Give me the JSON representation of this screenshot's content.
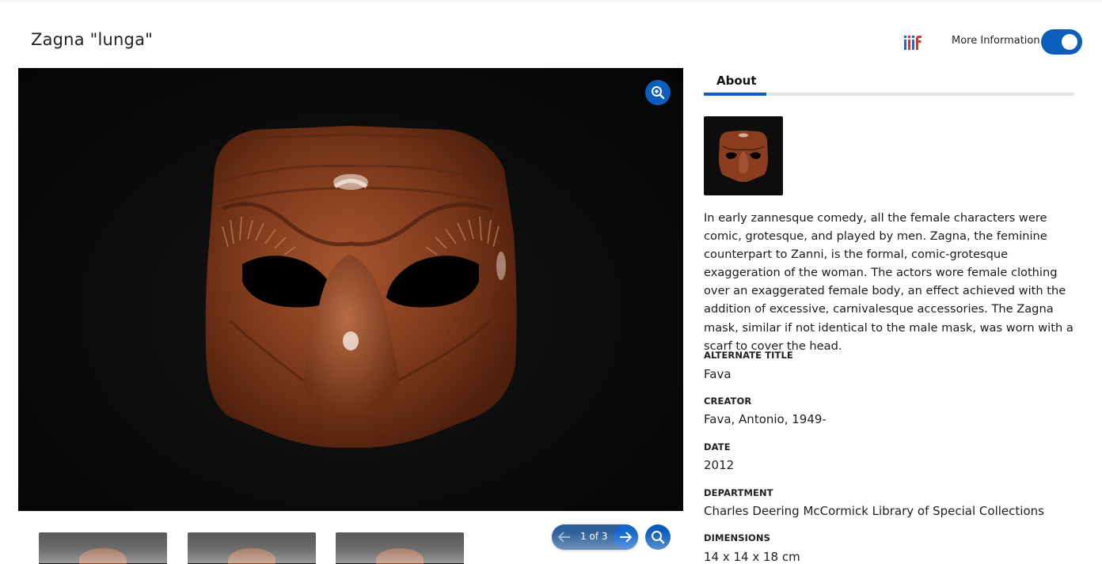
{
  "header": {
    "title": "Zagna \"lunga\"",
    "iiif_icon": "iiif-logo-icon",
    "more_info_label": "More Information",
    "more_info_enabled": true
  },
  "viewer": {
    "zoom_icon": "zoom-in-icon",
    "pager": {
      "label": "1 of 3",
      "current": 1,
      "total": 3
    },
    "search_icon": "search-icon",
    "thumbnail_count": 3
  },
  "sidebar": {
    "tabs": [
      {
        "label": "About",
        "active": true
      }
    ],
    "description": "In early zannesque comedy, all the female characters were comic, grotesque, and played by men. Zagna, the feminine counterpart to Zanni, is the formal, comic-grotesque exaggeration of the woman. The actors wore female clothing over an exaggerated female body, an effect achieved with the addition of excessive, carnivalesque accessories. The Zagna mask, similar if not identical to the male mask, was worn with a scarf to cover the head.",
    "metadata": [
      {
        "label": "ALTERNATE TITLE",
        "value": "Fava"
      },
      {
        "label": "CREATOR",
        "value": "Fava, Antonio, 1949-"
      },
      {
        "label": "DATE",
        "value": "2012"
      },
      {
        "label": "DEPARTMENT",
        "value": "Charles Deering McCormick Library of Special Collections"
      },
      {
        "label": "DIMENSIONS",
        "value": "14 x 14 x 18 cm"
      }
    ]
  },
  "colors": {
    "accent": "#0b5ebc",
    "mask_brown": "#8a3d1f",
    "viewer_bg": "#0b0b0b"
  }
}
